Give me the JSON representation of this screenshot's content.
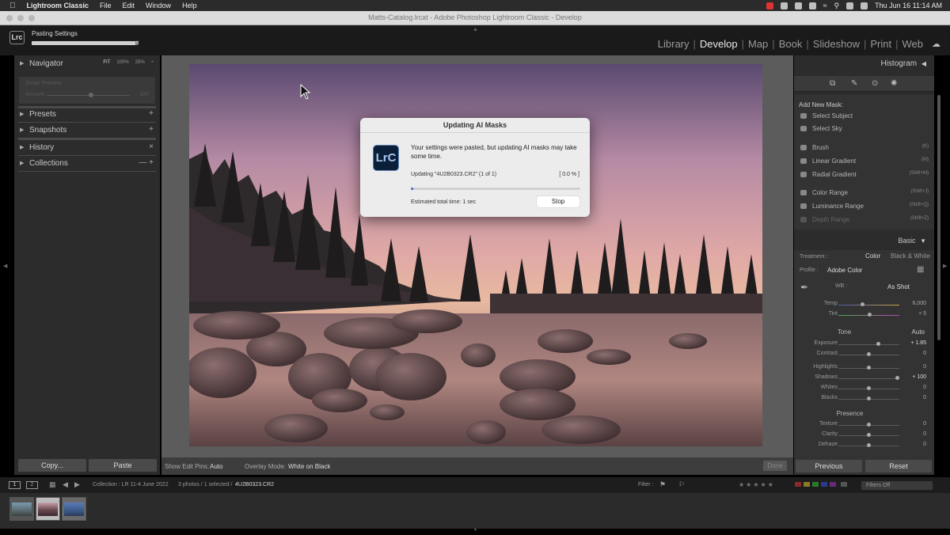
{
  "macbar": {
    "apple": "",
    "app": "Lightroom Classic",
    "menus": [
      "File",
      "Edit",
      "Window",
      "Help"
    ],
    "datetime": "Thu Jun 16  11:14 AM"
  },
  "window": {
    "title": "Matts-Catalog.lrcat - Adobe Photoshop Lightroom Classic - Develop"
  },
  "lr": {
    "logo": "Lrc",
    "progress": {
      "label": "Pasting Settings",
      "fraction": 0.97,
      "close": "×"
    },
    "modules": [
      "Library",
      "Develop",
      "Map",
      "Book",
      "Slideshow",
      "Print",
      "Web"
    ],
    "active_module": "Develop"
  },
  "left": {
    "navigator": {
      "label": "Navigator",
      "zoom": [
        "FIT",
        "100%",
        "25%",
        "÷"
      ],
      "preview_t1": "Smart Preview",
      "preview_t2": "Amount",
      "preview_t3": "100"
    },
    "presets": {
      "label": "Presets",
      "action": "+"
    },
    "snapshots": {
      "label": "Snapshots",
      "action": "+"
    },
    "history": {
      "label": "History",
      "action": "×"
    },
    "collections": {
      "label": "Collections",
      "action": "— +"
    },
    "copy_label": "Copy...",
    "paste_label": "Paste"
  },
  "toolbar": {
    "pins_label": "Show Edit Pins:",
    "pins_value": "Auto",
    "overlay_label": "Overlay Mode:",
    "overlay_value": "White on Black",
    "done_label": "Done"
  },
  "dialog": {
    "title": "Updating AI Masks",
    "logo": "LrC",
    "message": "Your settings were pasted, but updating AI masks may take some time.",
    "updating": "Updating \"4U2B0323.CR2\" (1 of 1)",
    "percent": "[ 0.0 % ]",
    "progress_fraction": 0.01,
    "estimate": "Estimated total time: 1 sec",
    "stop_label": "Stop"
  },
  "right": {
    "histogram": "Histogram",
    "add_mask_label": "Add New Mask:",
    "mask_options": [
      {
        "label": "Select Subject",
        "key": ""
      },
      {
        "label": "Select Sky",
        "key": ""
      },
      {
        "label": "Brush",
        "key": "(K)"
      },
      {
        "label": "Linear Gradient",
        "key": "(M)"
      },
      {
        "label": "Radial Gradient",
        "key": "(Shift+M)"
      },
      {
        "label": "Color Range",
        "key": "(Shift+J)"
      },
      {
        "label": "Luminance Range",
        "key": "(Shift+Q)"
      },
      {
        "label": "Depth Range",
        "key": "(Shift+Z)"
      }
    ],
    "basic": {
      "header": "Basic",
      "treatment_label": "Treatment :",
      "treatment_color": "Color",
      "treatment_bw": "Black & White",
      "profile_label": "Profile :",
      "profile_value": "Adobe Color",
      "wb_label": "WB :",
      "wb_value": "As Shot",
      "temp": {
        "label": "Temp",
        "value": "6,000"
      },
      "tint": {
        "label": "Tint",
        "value": "+ 5"
      },
      "tone_label": "Tone",
      "auto_label": "Auto",
      "exposure": {
        "label": "Exposure",
        "value": "+ 1.85"
      },
      "contrast": {
        "label": "Contrast",
        "value": "0"
      },
      "highlights": {
        "label": "Highlights",
        "value": "0"
      },
      "shadows": {
        "label": "Shadows",
        "value": "+ 100"
      },
      "whites": {
        "label": "Whites",
        "value": "0"
      },
      "blacks": {
        "label": "Blacks",
        "value": "0"
      },
      "presence_label": "Presence",
      "texture": {
        "label": "Texture",
        "value": "0"
      },
      "clarity": {
        "label": "Clarity",
        "value": "0"
      },
      "dehaze": {
        "label": "Dehaze",
        "value": "0"
      }
    },
    "previous_label": "Previous",
    "reset_label": "Reset"
  },
  "filmbar": {
    "screen1": "1",
    "screen2": "2",
    "collection": "Collection : LR 11-4 June 2022",
    "count": "3 photos / 1 selected /",
    "filename": "4U2B0323.CR2",
    "filter_label": "Filter :",
    "filters_off": "Filters Off"
  },
  "colors": {
    "accent": "#5a6ad0",
    "panel": "#2c2c2c",
    "dialog_bg": "#ececec"
  }
}
